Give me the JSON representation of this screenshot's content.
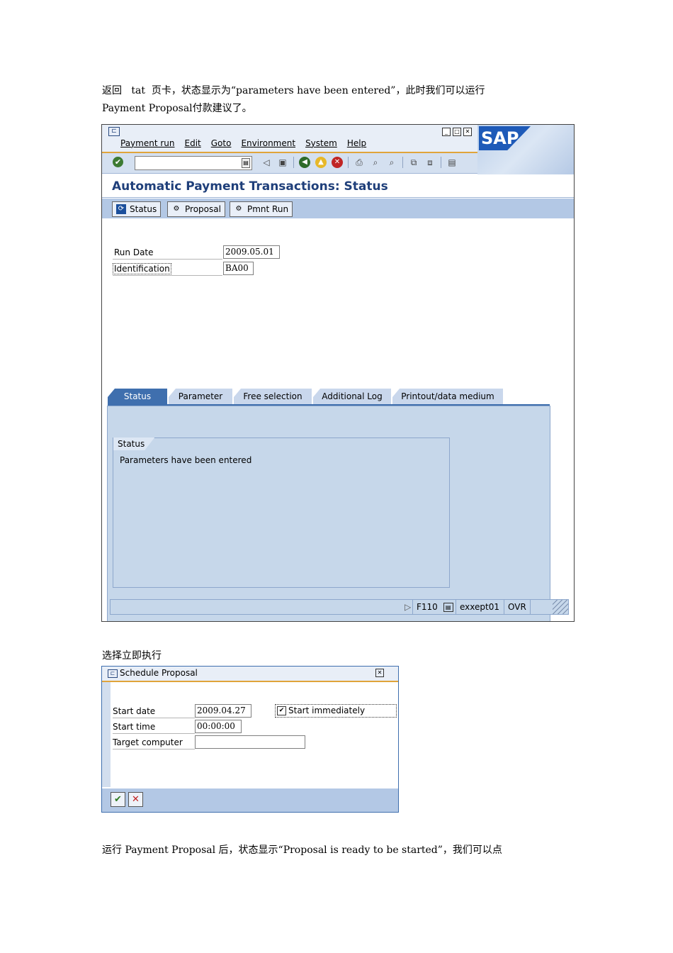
{
  "doc": {
    "para1_line1": "返回   tat  页卡，状态显示为“parameters have been entered”，此时我们可以运行",
    "para1_line2": "Payment Proposal付款建议了。",
    "para2": "选择立即执行",
    "para3": "运行 Payment Proposal 后，状态显示“Proposal is ready to be started”，我们可以点"
  },
  "main_window": {
    "menu": [
      "Payment run",
      "Edit",
      "Goto",
      "Environment",
      "System",
      "Help"
    ],
    "logo": "SAP",
    "title": "Automatic Payment Transactions: Status",
    "app_buttons": [
      "Status",
      "Proposal",
      "Pmnt Run"
    ],
    "fields": {
      "run_date_label": "Run Date",
      "run_date_value": "2009.05.01",
      "identification_label": "Identification",
      "identification_value": "BA00"
    },
    "tabs": [
      "Status",
      "Parameter",
      "Free selection",
      "Additional Log",
      "Printout/data medium"
    ],
    "status_group": {
      "title": "Status",
      "text": "Parameters have been entered"
    },
    "status_bar": {
      "transaction": "F110",
      "server": "exxept01",
      "mode": "OVR"
    }
  },
  "dialog": {
    "title": "Schedule Proposal",
    "start_date_label": "Start date",
    "start_date_value": "2009.04.27",
    "start_time_label": "Start time",
    "start_time_value": "00:00:00",
    "target_computer_label": "Target computer",
    "target_computer_value": "",
    "start_immediately_label": "Start immediately",
    "start_immediately_checked": true
  },
  "colors": {
    "accent_orange": "#e0a43a",
    "title_blue": "#1f3f7a",
    "panel_blue": "#c6d7ea",
    "tab_active": "#3f6fae"
  }
}
